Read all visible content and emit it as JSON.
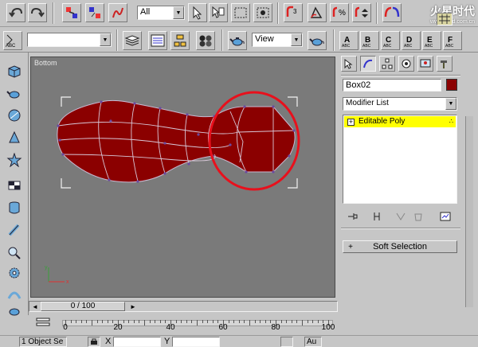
{
  "toolbar": {
    "selection_filter": "All",
    "ref_coord": "View",
    "named_selection": ""
  },
  "viewport": {
    "label": "Bottom",
    "axis_x": "x",
    "axis_y": "y"
  },
  "command_panel": {
    "object_name": "Box02",
    "object_color": "#8b0000",
    "modifier_list": "Modifier List",
    "stack_item": "Editable Poly",
    "rollout": "Soft Selection"
  },
  "timeline": {
    "frame_display": "0 / 100",
    "ticks": [
      "0",
      "20",
      "40",
      "60",
      "80",
      "100"
    ]
  },
  "status": {
    "selection": "1 Object Se",
    "x_label": "X",
    "y_label": "Y",
    "auto_key": "Au"
  },
  "watermark": {
    "main": "火星时代",
    "sub": "www.hxsd.com.cn"
  },
  "colors": {
    "mesh": "#8b0000",
    "highlight_circle": "#e8101c",
    "stack_highlight": "#ffff00"
  }
}
